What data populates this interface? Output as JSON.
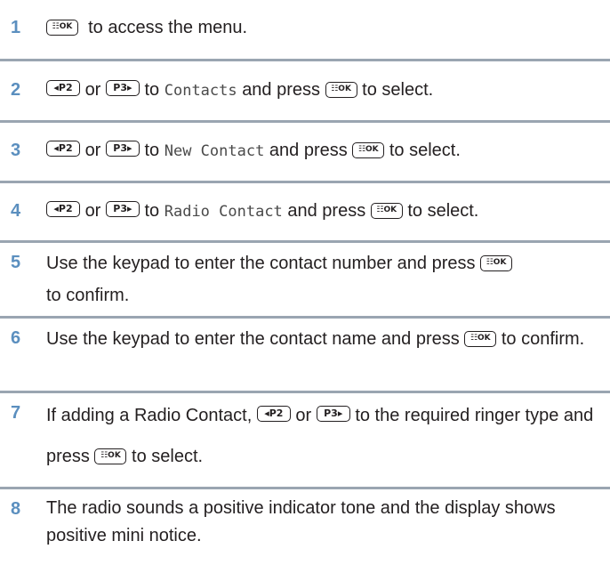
{
  "steps": [
    {
      "number": "1",
      "parts": [
        "to access the menu."
      ]
    },
    {
      "number": "2",
      "parts": [
        "or",
        "to",
        "Contacts",
        "and press",
        "to select."
      ]
    },
    {
      "number": "3",
      "parts": [
        "or",
        "to",
        "New Contact",
        "and press",
        "to select."
      ]
    },
    {
      "number": "4",
      "parts": [
        "or",
        "to",
        "Radio Contact",
        "and press",
        "to select."
      ]
    },
    {
      "number": "5",
      "parts": [
        "Use the keypad to enter the contact number and press",
        "to confirm."
      ]
    },
    {
      "number": "6",
      "parts": [
        "Use the keypad to enter the contact name and press",
        "to confirm."
      ]
    },
    {
      "number": "7",
      "parts": [
        "If adding a Radio Contact,",
        "or",
        "to the required ringer type and press",
        "to select."
      ]
    },
    {
      "number": "8",
      "parts": [
        "The radio sounds a positive indicator tone and the display shows positive mini notice."
      ]
    }
  ],
  "keys": {
    "ok": "☷OK",
    "p2": "◂P2",
    "p3": "P3▸"
  },
  "colors": {
    "step_number": "#5b8fbf",
    "divider": "#9aa5b1",
    "text": "#231f20"
  }
}
